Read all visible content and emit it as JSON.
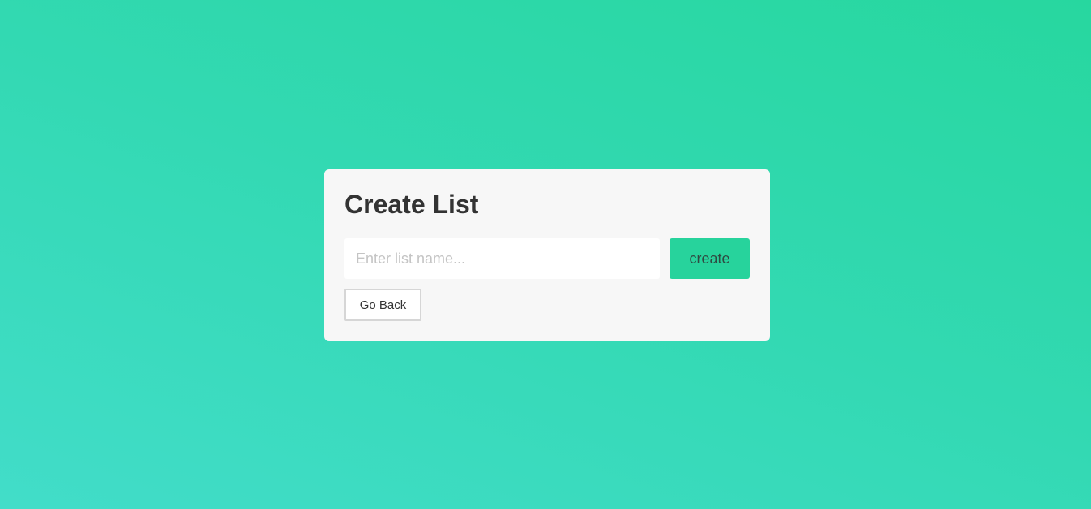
{
  "card": {
    "title": "Create List",
    "input": {
      "value": "",
      "placeholder": "Enter list name..."
    },
    "create_label": "create",
    "back_label": "Go Back"
  },
  "colors": {
    "background_start": "#27d79f",
    "background_end": "#42ddc9",
    "accent": "#27d39c",
    "card_background": "#f7f7f7"
  }
}
